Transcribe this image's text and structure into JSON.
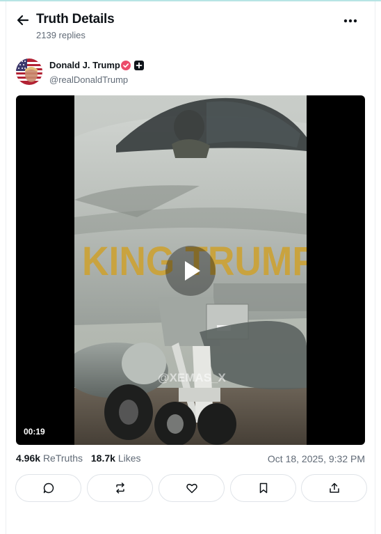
{
  "header": {
    "title": "Truth Details",
    "replies": "2139 replies",
    "back_icon": "arrow-left-icon",
    "more_icon": "more-horizontal-icon"
  },
  "post": {
    "author_name": "Donald J. Trump",
    "handle": "@realDonaldTrump",
    "verified_icon": "verified-badge-icon",
    "verified_color": "#ec4b6a",
    "plus_icon": "plus-badge-icon",
    "video": {
      "duration": "00:19",
      "overlay_text": "KING TRUMP",
      "watermark": "@XEMAS_X"
    },
    "stats": {
      "retruths_count": "4.96k",
      "retruths_label": "ReTruths",
      "likes_count": "18.7k",
      "likes_label": "Likes"
    },
    "timestamp": "Oct 18, 2025, 9:32 PM"
  },
  "actions": [
    {
      "name": "reply",
      "icon": "comment-icon"
    },
    {
      "name": "retruth",
      "icon": "repost-icon"
    },
    {
      "name": "like",
      "icon": "heart-icon"
    },
    {
      "name": "bookmark",
      "icon": "bookmark-icon"
    },
    {
      "name": "share",
      "icon": "share-icon"
    }
  ]
}
